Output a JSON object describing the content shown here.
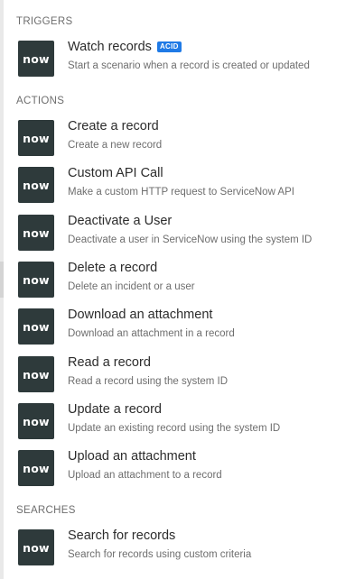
{
  "logo_text": "now",
  "colors": {
    "logo_bg": "#2e3a3b",
    "badge_bg": "#1f7ae6",
    "title": "#2c2c2c",
    "muted": "#6e6e6e"
  },
  "sections": [
    {
      "header": "TRIGGERS",
      "items": [
        {
          "icon": "servicenow-logo-icon",
          "title": "Watch records",
          "badge": "ACID",
          "description": "Start a scenario when a record is created or updated"
        }
      ]
    },
    {
      "header": "ACTIONS",
      "items": [
        {
          "icon": "servicenow-logo-icon",
          "title": "Create a record",
          "description": "Create a new record"
        },
        {
          "icon": "servicenow-logo-icon",
          "title": "Custom API Call",
          "description": "Make a custom HTTP request to ServiceNow API"
        },
        {
          "icon": "servicenow-logo-icon",
          "title": "Deactivate a User",
          "description": "Deactivate a user in ServiceNow using the system ID"
        },
        {
          "icon": "servicenow-logo-icon",
          "title": "Delete a record",
          "description": "Delete an incident or a user"
        },
        {
          "icon": "servicenow-logo-icon",
          "title": "Download an attachment",
          "description": "Download an attachment in a record"
        },
        {
          "icon": "servicenow-logo-icon",
          "title": "Read a record",
          "description": "Read a record using the system ID"
        },
        {
          "icon": "servicenow-logo-icon",
          "title": "Update a record",
          "description": "Update an existing record using the system ID"
        },
        {
          "icon": "servicenow-logo-icon",
          "title": "Upload an attachment",
          "description": "Upload an attachment to a record"
        }
      ]
    },
    {
      "header": "SEARCHES",
      "items": [
        {
          "icon": "servicenow-logo-icon",
          "title": "Search for records",
          "description": "Search for records using custom criteria"
        }
      ]
    }
  ]
}
